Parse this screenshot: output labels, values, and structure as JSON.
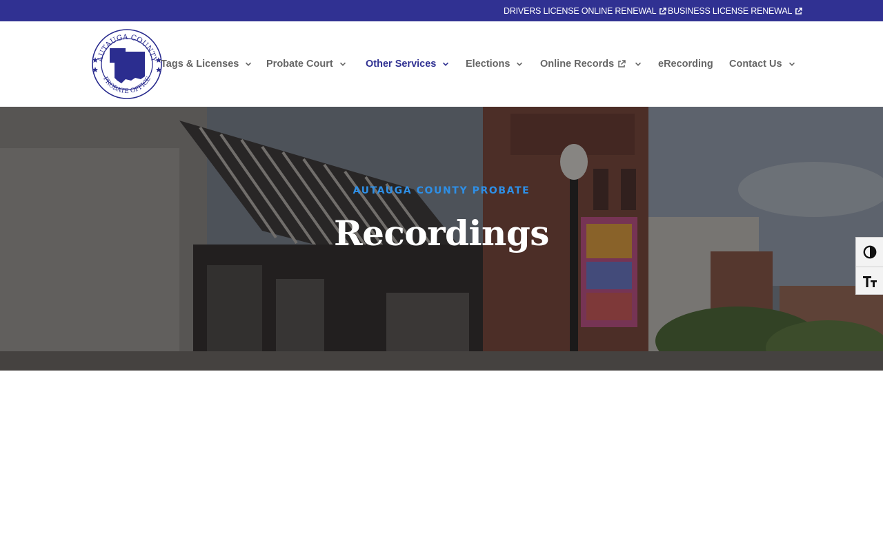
{
  "topbar": {
    "links": [
      {
        "label": "DRIVERS LICENSE ONLINE RENEWAL",
        "icon": "external-link-icon"
      },
      {
        "label": "BUSINESS LICENSE RENEWAL",
        "icon": "external-link-icon"
      }
    ]
  },
  "header": {
    "logo": {
      "ring_text_top": "AUTAUGA COUNTY",
      "ring_text_bottom": "PROBATE OFFICE",
      "color": "#2b2d8f"
    },
    "nav": [
      {
        "label": "Tags & Licenses",
        "icon": "chevron-down-icon"
      },
      {
        "label": "Probate Court",
        "icon": "chevron-down-icon"
      },
      {
        "label": "Other Services",
        "icon": "chevron-down-icon",
        "active": true
      },
      {
        "label": "Elections",
        "icon": "chevron-down-icon"
      },
      {
        "label": "Online Records",
        "icon": "chevron-down-icon",
        "external": true
      },
      {
        "label": "eRecording"
      },
      {
        "label": "Contact Us",
        "icon": "chevron-down-icon"
      }
    ]
  },
  "hero": {
    "eyebrow": "AUTAUGA COUNTY PROBATE",
    "title": "Recordings",
    "eyebrow_color": "#2e8fe6"
  },
  "accessibility": {
    "buttons": [
      {
        "icon": "contrast-toggle-icon"
      },
      {
        "icon": "font-size-toggle-icon"
      }
    ]
  },
  "colors": {
    "brand": "#303192",
    "nav_text": "#666666",
    "nav_active": "#303192"
  }
}
